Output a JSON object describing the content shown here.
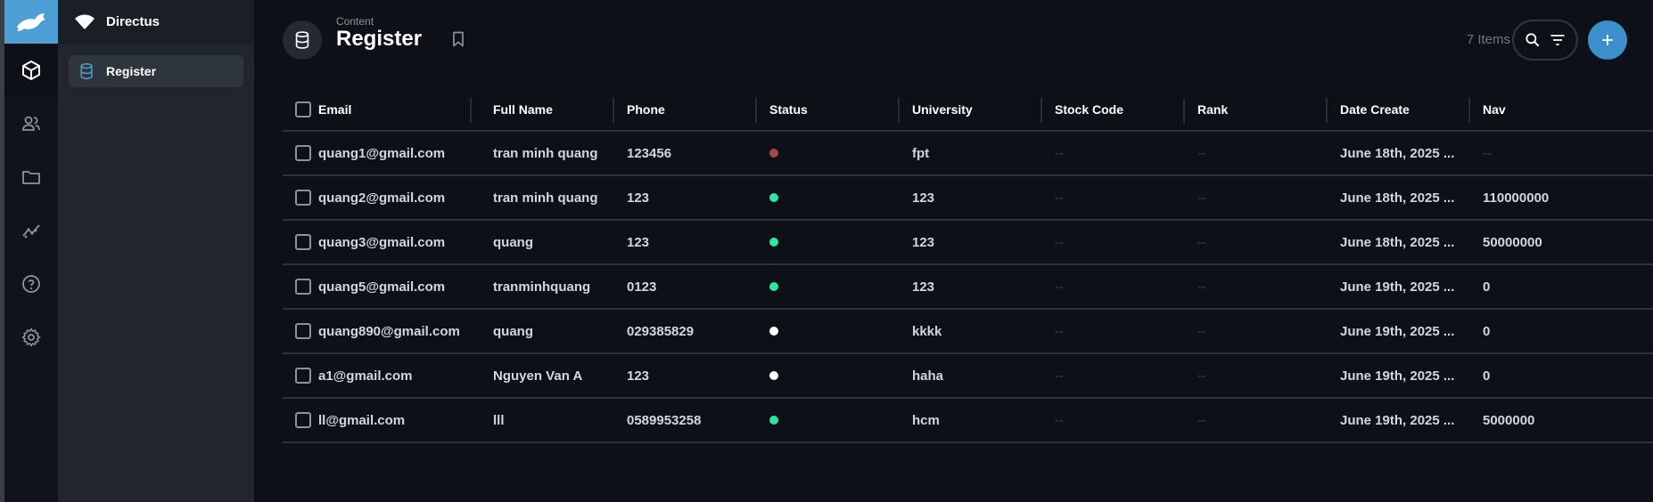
{
  "app": {
    "name": "Directus"
  },
  "navigation": {
    "items": [
      {
        "label": "Register",
        "icon": "database-icon"
      }
    ]
  },
  "header": {
    "breadcrumb": "Content",
    "title": "Register",
    "item_count": "7 Items"
  },
  "colors": {
    "accent": "#3d8fcc",
    "logo_bg": "#4b9fd5",
    "status_published": "#2ee6a0",
    "status_archived": "#a34a44",
    "status_draft": "#ffffff"
  },
  "table": {
    "columns": [
      "Email",
      "Full Name",
      "Phone",
      "Status",
      "University",
      "Stock Code",
      "Rank",
      "Date Create",
      "Nav"
    ],
    "rows": [
      {
        "email": "quang1@gmail.com",
        "full_name": "tran minh quang",
        "phone": "123456",
        "status": "archived",
        "university": "fpt",
        "stock_code": "--",
        "rank": "--",
        "date_create": "June 18th, 2025 ...",
        "nav": "--"
      },
      {
        "email": "quang2@gmail.com",
        "full_name": "tran minh quang",
        "phone": "123",
        "status": "published",
        "university": "123",
        "stock_code": "--",
        "rank": "--",
        "date_create": "June 18th, 2025 ...",
        "nav": "110000000"
      },
      {
        "email": "quang3@gmail.com",
        "full_name": "quang",
        "phone": "123",
        "status": "published",
        "university": "123",
        "stock_code": "--",
        "rank": "--",
        "date_create": "June 18th, 2025 ...",
        "nav": "50000000"
      },
      {
        "email": "quang5@gmail.com",
        "full_name": "tranminhquang",
        "phone": "0123",
        "status": "published",
        "university": "123",
        "stock_code": "--",
        "rank": "--",
        "date_create": "June 19th, 2025 ...",
        "nav": "0"
      },
      {
        "email": "quang890@gmail.com",
        "full_name": "quang",
        "phone": "029385829",
        "status": "draft",
        "university": "kkkk",
        "stock_code": "--",
        "rank": "--",
        "date_create": "June 19th, 2025 ...",
        "nav": "0"
      },
      {
        "email": "a1@gmail.com",
        "full_name": "Nguyen Van A",
        "phone": "123",
        "status": "draft",
        "university": "haha",
        "stock_code": "--",
        "rank": "--",
        "date_create": "June 19th, 2025 ...",
        "nav": "0"
      },
      {
        "email": "ll@gmail.com",
        "full_name": "lll",
        "phone": "0589953258",
        "status": "published",
        "university": "hcm",
        "stock_code": "--",
        "rank": "--",
        "date_create": "June 19th, 2025 ...",
        "nav": "5000000"
      }
    ]
  }
}
